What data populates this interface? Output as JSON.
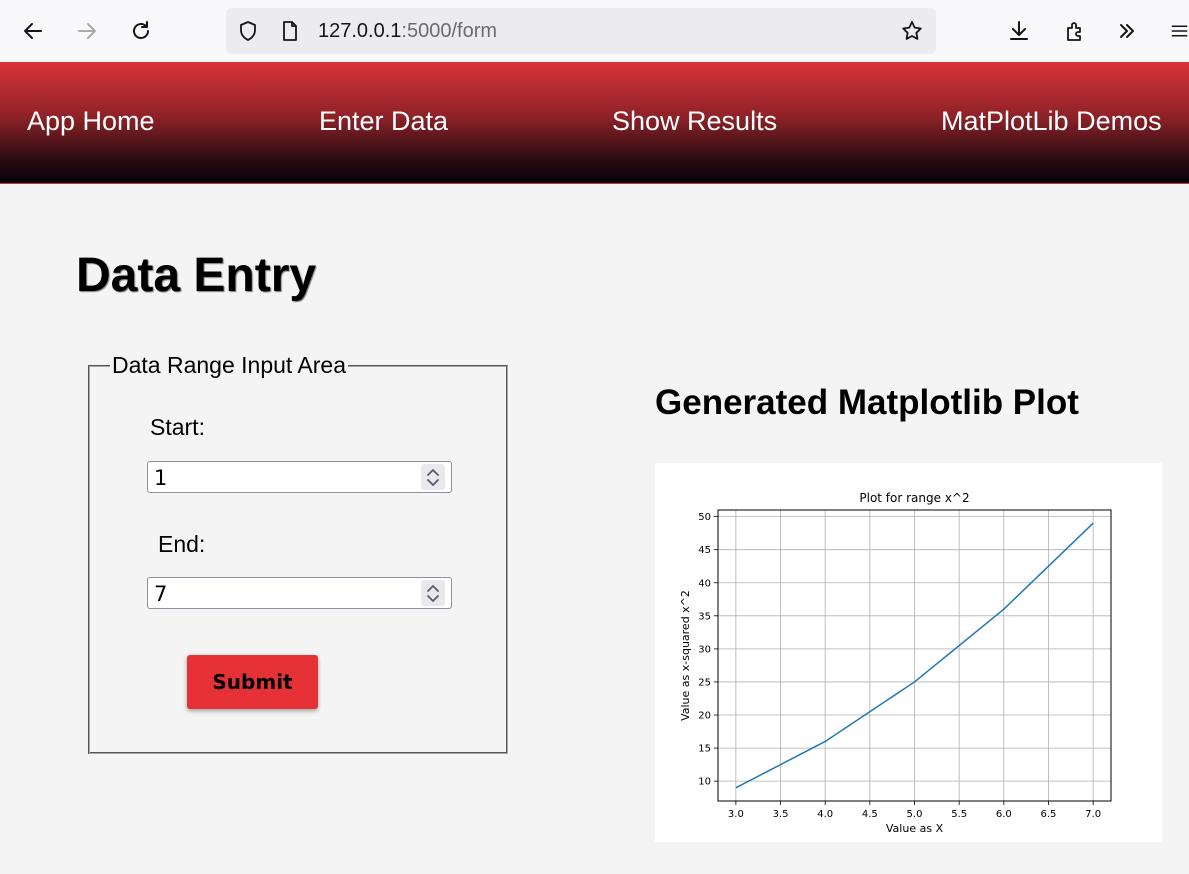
{
  "browser": {
    "url_host": "127.0.0.1",
    "url_path": ":5000/form",
    "icons": [
      "back-arrow-icon",
      "forward-arrow-icon",
      "reload-icon",
      "shield-icon",
      "page-icon",
      "star-icon",
      "download-icon",
      "extensions-icon",
      "overflow-chevrons-icon",
      "menu-icon"
    ]
  },
  "nav": {
    "items": [
      {
        "label": "App Home"
      },
      {
        "label": "Enter Data"
      },
      {
        "label": "Show Results"
      },
      {
        "label": "MatPlotLib Demos"
      }
    ],
    "gradient_top": "#d93237",
    "gradient_bottom": "#07030a"
  },
  "page": {
    "title": "Data Entry"
  },
  "form": {
    "legend": "Data Range Input Area",
    "start_label": "Start:",
    "start_value": "1",
    "end_label": "End:",
    "end_value": "7",
    "submit_label": "Submit",
    "submit_color": "#e63237"
  },
  "plot_section": {
    "heading": "Generated Matplotlib Plot"
  },
  "chart_data": {
    "type": "line",
    "title": "Plot for range x^2",
    "xlabel": "Value as X",
    "ylabel": "Value as x-squared x^2",
    "x": [
      3,
      4,
      5,
      6,
      7
    ],
    "series": [
      {
        "values": [
          9,
          16,
          25,
          36,
          49
        ],
        "color": "#1f77b4"
      }
    ],
    "xlim": [
      2.8,
      7.2
    ],
    "ylim": [
      7,
      51
    ],
    "xticks": [
      "3.0",
      "3.5",
      "4.0",
      "4.5",
      "5.0",
      "5.5",
      "6.0",
      "6.5",
      "7.0"
    ],
    "yticks": [
      "10",
      "15",
      "20",
      "25",
      "30",
      "35",
      "40",
      "45",
      "50"
    ],
    "grid": true
  }
}
